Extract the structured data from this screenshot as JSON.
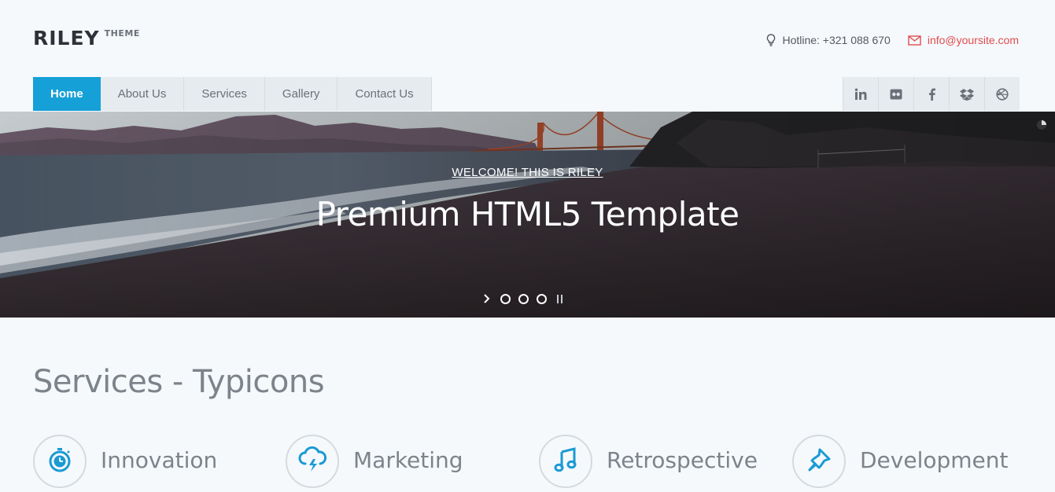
{
  "brand": {
    "name": "RILEY",
    "sub": "THEME"
  },
  "contact": {
    "hotline": "Hotline: +321 088 670",
    "email": "info@yoursite.com"
  },
  "nav": {
    "items": [
      {
        "label": "Home"
      },
      {
        "label": "About Us"
      },
      {
        "label": "Services"
      },
      {
        "label": "Gallery"
      },
      {
        "label": "Contact Us"
      }
    ]
  },
  "social": {
    "icons": [
      "linkedin-icon",
      "flickr-icon",
      "facebook-icon",
      "dropbox-icon",
      "dribbble-icon"
    ]
  },
  "hero": {
    "kicker": "WELCOME! THIS IS RILEY",
    "title": "Premium HTML5 Template",
    "slides_count": 3
  },
  "services": {
    "title": "Services - Typicons",
    "items": [
      {
        "label": "Innovation",
        "icon": "stopwatch-icon"
      },
      {
        "label": "Marketing",
        "icon": "cloud-storm-icon"
      },
      {
        "label": "Retrospective",
        "icon": "music-note-icon"
      },
      {
        "label": "Development",
        "icon": "pin-icon"
      }
    ]
  },
  "colors": {
    "accent": "#16a0d8",
    "email": "#e24c4c",
    "text": "#7d838a"
  }
}
